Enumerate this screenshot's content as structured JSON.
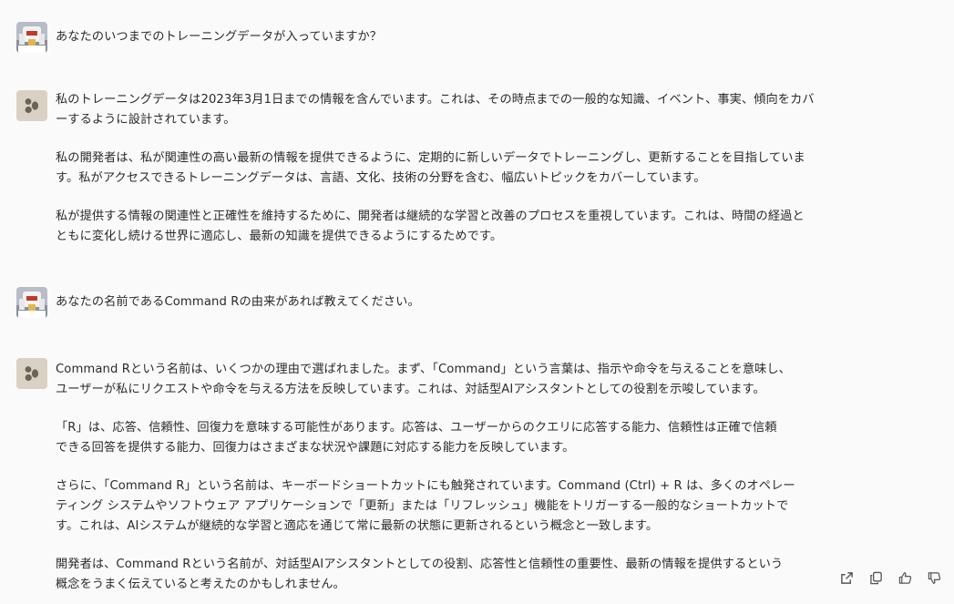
{
  "conversation": {
    "messages": [
      {
        "role": "user",
        "paragraphs": [
          [
            "あなたのいつまでのトレーニングデータが入っていますか？"
          ]
        ]
      },
      {
        "role": "assistant",
        "paragraphs": [
          [
            "私のトレーニングデータは2023年3月1日までの情報を含んでいます。これは、その時点までの一般的な知識、イベント、事実、傾向をカバ",
            "ーするように設計されています。"
          ],
          [
            "私の開発者は、私が関連性の高い最新の情報を提供できるように、定期的に新しいデータでトレーニングし、更新することを目指していま",
            "す。私がアクセスできるトレーニングデータは、言語、文化、技術の分野を含む、幅広いトピックをカバーしています。"
          ],
          [
            "私が提供する情報の関連性と正確性を維持するために、開発者は継続的な学習と改善のプロセスを重視しています。これは、時間の経過と",
            "ともに変化し続ける世界に適応し、最新の知識を提供できるようにするためです。"
          ]
        ]
      },
      {
        "role": "user",
        "paragraphs": [
          [
            "あなたの名前であるCommand Rの由来があれば教えてください。"
          ]
        ]
      },
      {
        "role": "assistant",
        "paragraphs": [
          [
            "Command Rという名前は、いくつかの理由で選ばれました。まず、「Command」という言葉は、指示や命令を与えることを意味し、",
            "ユーザーが私にリクエストや命令を与える方法を反映しています。これは、対話型AIアシスタントとしての役割を示唆しています。"
          ],
          [
            "「R」は、応答、信頼性、回復力を意味する可能性があります。応答は、ユーザーからのクエリに応答する能力、信頼性は正確で信頼",
            "できる回答を提供する能力、回復力はさまざまな状況や課題に対応する能力を反映しています。"
          ],
          [
            "さらに、「Command R」という名前は、キーボードショートカットにも触発されています。Command (Ctrl) + R は、多くのオペレー",
            "ティング システムやソフトウェア アプリケーションで「更新」または「リフレッシュ」機能をトリガーする一般的なショートカットで",
            "す。これは、AIシステムが継続的な学習と適応を通じて常に最新の状態に更新されるという概念と一致します。"
          ],
          [
            "開発者は、Command Rという名前が、対話型AIアシスタントとしての役割、応答性と信頼性の重要性、最新の情報を提供するという",
            "概念をうまく伝えていると考えたのかもしれません。"
          ]
        ]
      }
    ]
  },
  "actions": [
    {
      "icon": "share-icon"
    },
    {
      "icon": "copy-icon"
    },
    {
      "icon": "thumbs-up-icon"
    },
    {
      "icon": "thumbs-down-icon"
    }
  ],
  "colors": {
    "background": "#fafafa",
    "text": "#2b2b2b",
    "bot_avatar_bg": "#d9d2c4",
    "bot_avatar_fg": "#6b6357",
    "icon": "#555555"
  }
}
